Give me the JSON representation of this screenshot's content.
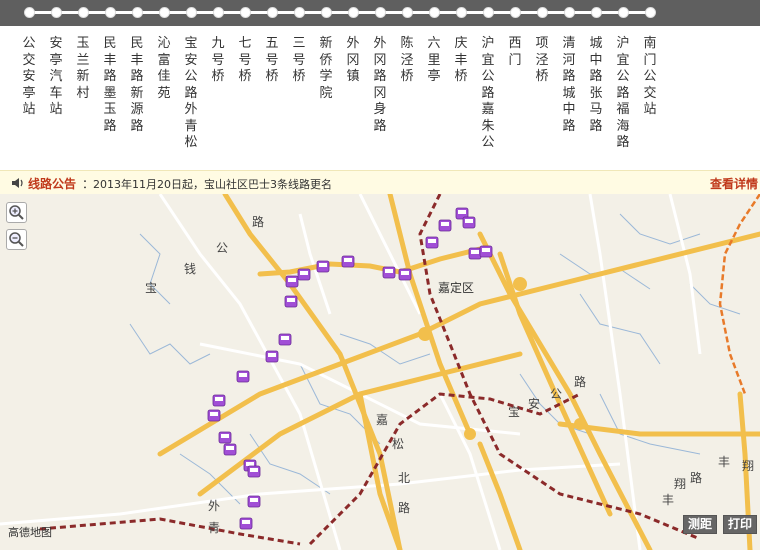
{
  "route": {
    "stops": [
      {
        "name": "公交安亭站"
      },
      {
        "name": "安亭汽车站"
      },
      {
        "name": "玉兰新村"
      },
      {
        "name": "民丰路墨玉路"
      },
      {
        "name": "民丰路新源路"
      },
      {
        "name": "沁富佳苑"
      },
      {
        "name": "宝安公路外青松"
      },
      {
        "name": "九号桥"
      },
      {
        "name": "七号桥"
      },
      {
        "name": "五号桥"
      },
      {
        "name": "三号桥"
      },
      {
        "name": "新侨学院"
      },
      {
        "name": "外冈镇"
      },
      {
        "name": "外冈路冈身路"
      },
      {
        "name": "陈泾桥"
      },
      {
        "name": "六里亭"
      },
      {
        "name": "庆丰桥"
      },
      {
        "name": "沪宜公路嘉朱公"
      },
      {
        "name": "西门"
      },
      {
        "name": "项泾桥"
      },
      {
        "name": "清河路城中路"
      },
      {
        "name": "城中路张马路"
      },
      {
        "name": "沪宜公路福海路"
      },
      {
        "name": "南门公交站"
      }
    ]
  },
  "notice": {
    "label": "线路公告",
    "colon": "：",
    "text": "2013年11月20日起，宝山社区巴士3条线路更名",
    "more_link": "查看详情"
  },
  "map": {
    "labels": {
      "road_lu_top": "路",
      "road_gong": "公",
      "road_qian": "钱",
      "road_bao": "宝",
      "district": "嘉定区",
      "road_lu_right": "路",
      "road_gong_right": "公",
      "road_an": "安",
      "road_bao_right": "宝",
      "road_jia": "嘉",
      "road_song": "松",
      "road_bei": "北",
      "road_lu_bottom": "路",
      "road_wai": "外",
      "road_qing": "青",
      "road_feng": "丰",
      "road_xiang": "翔",
      "road_lu_br": "路",
      "road_xiang2": "翔",
      "road_feng2": "丰"
    },
    "credit": "高德地图",
    "tools": {
      "measure": "测距",
      "print": "打印"
    },
    "colors": {
      "background": "#f3f0e7",
      "major_road": "#f2bf4c",
      "minor_road": "#ffffff",
      "railway": "#8b2a2a",
      "water": "#9bb8d8",
      "bus_stop": "#a14fd6"
    },
    "icons": {
      "zoom_in": "zoom-in-icon",
      "zoom_out": "zoom-out-icon",
      "speaker": "speaker-icon",
      "bus_stop": "bus-stop-icon"
    }
  }
}
